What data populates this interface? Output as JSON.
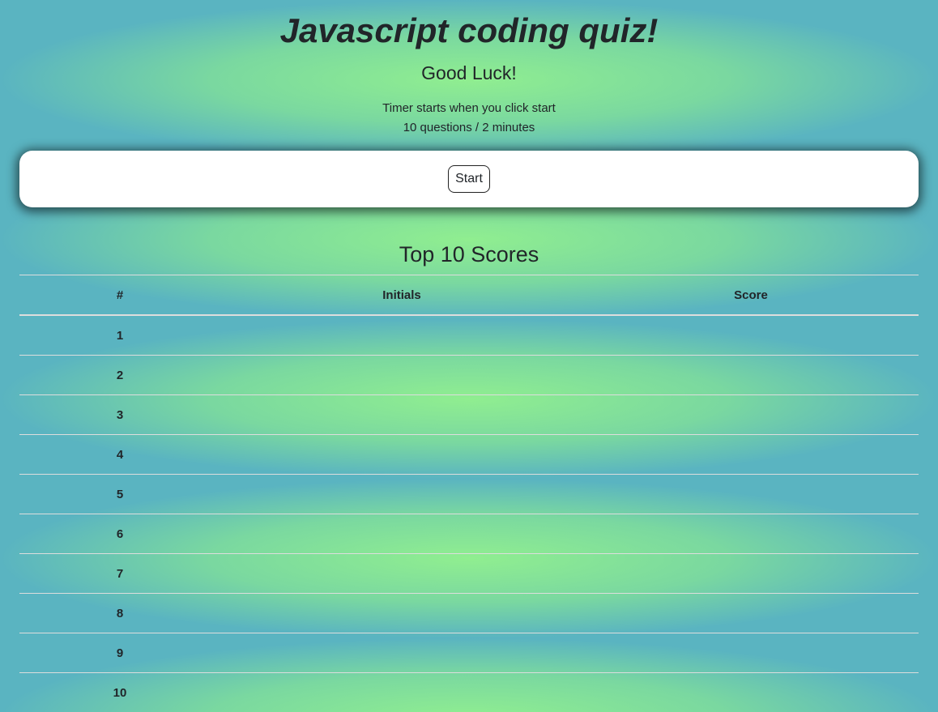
{
  "header": {
    "title": "Javascript coding quiz!",
    "subtitle": "Good Luck!",
    "info_line1": "Timer starts when you click start",
    "info_line2": "10 questions / 2 minutes"
  },
  "quiz_card": {
    "start_label": "Start"
  },
  "scores": {
    "title": "Top 10 Scores",
    "columns": [
      "#",
      "Initials",
      "Score"
    ],
    "rows": [
      {
        "rank": "1",
        "initials": "",
        "score": ""
      },
      {
        "rank": "2",
        "initials": "",
        "score": ""
      },
      {
        "rank": "3",
        "initials": "",
        "score": ""
      },
      {
        "rank": "4",
        "initials": "",
        "score": ""
      },
      {
        "rank": "5",
        "initials": "",
        "score": ""
      },
      {
        "rank": "6",
        "initials": "",
        "score": ""
      },
      {
        "rank": "7",
        "initials": "",
        "score": ""
      },
      {
        "rank": "8",
        "initials": "",
        "score": ""
      },
      {
        "rank": "9",
        "initials": "",
        "score": ""
      },
      {
        "rank": "10",
        "initials": "",
        "score": ""
      }
    ]
  },
  "colors": {
    "bg_center": "#90ee90",
    "bg_edge": "#5ab4c1"
  }
}
